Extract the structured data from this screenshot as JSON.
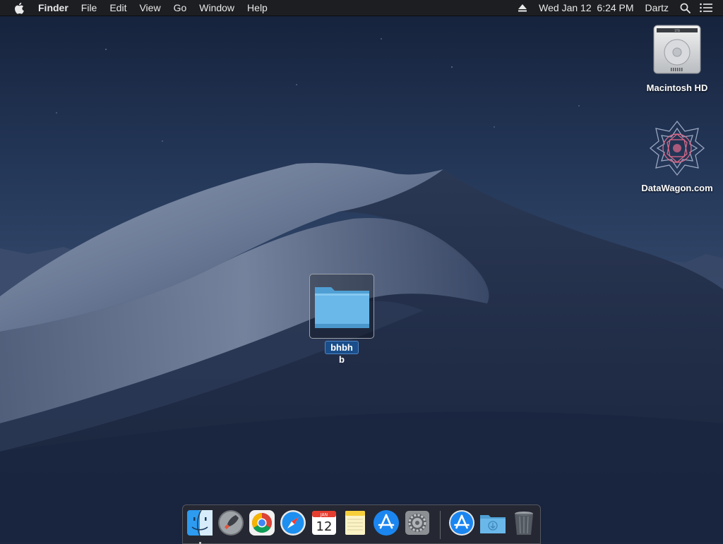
{
  "menubar": {
    "app_name": "Finder",
    "items": [
      "File",
      "Edit",
      "View",
      "Go",
      "Window",
      "Help"
    ],
    "clock": "Wed Jan 12  6:24 PM",
    "user": "Dartz"
  },
  "desktop": {
    "icons": [
      {
        "label": "Macintosh HD",
        "icon": "hard-drive-icon"
      },
      {
        "label": "DataWagon.com",
        "icon": "geometric-pattern-icon"
      }
    ],
    "selected_folder": {
      "name": "bhbhb",
      "icon": "folder-icon"
    }
  },
  "dock": {
    "items": [
      {
        "name": "Finder",
        "icon": "finder-icon",
        "running": true
      },
      {
        "name": "Launchpad",
        "icon": "launchpad-icon",
        "running": false
      },
      {
        "name": "Google Chrome",
        "icon": "chrome-icon",
        "running": false
      },
      {
        "name": "Safari",
        "icon": "safari-icon",
        "running": false
      },
      {
        "name": "Calendar",
        "icon": "calendar-icon",
        "running": false,
        "date": "12",
        "month": "JAN"
      },
      {
        "name": "Notes",
        "icon": "notes-icon",
        "running": false
      },
      {
        "name": "App Store",
        "icon": "app-store-icon",
        "running": false
      },
      {
        "name": "System Preferences",
        "icon": "system-preferences-icon",
        "running": false
      },
      {
        "name": "App Store",
        "icon": "app-store-icon",
        "running": false
      },
      {
        "name": "Downloads",
        "icon": "downloads-folder-icon",
        "running": false
      },
      {
        "name": "Trash",
        "icon": "trash-icon",
        "running": false
      }
    ]
  },
  "colors": {
    "folder_blue": "#5cb3e8",
    "selection_blue": "#1a4e8a",
    "menubar_bg": "#1e1e20"
  }
}
